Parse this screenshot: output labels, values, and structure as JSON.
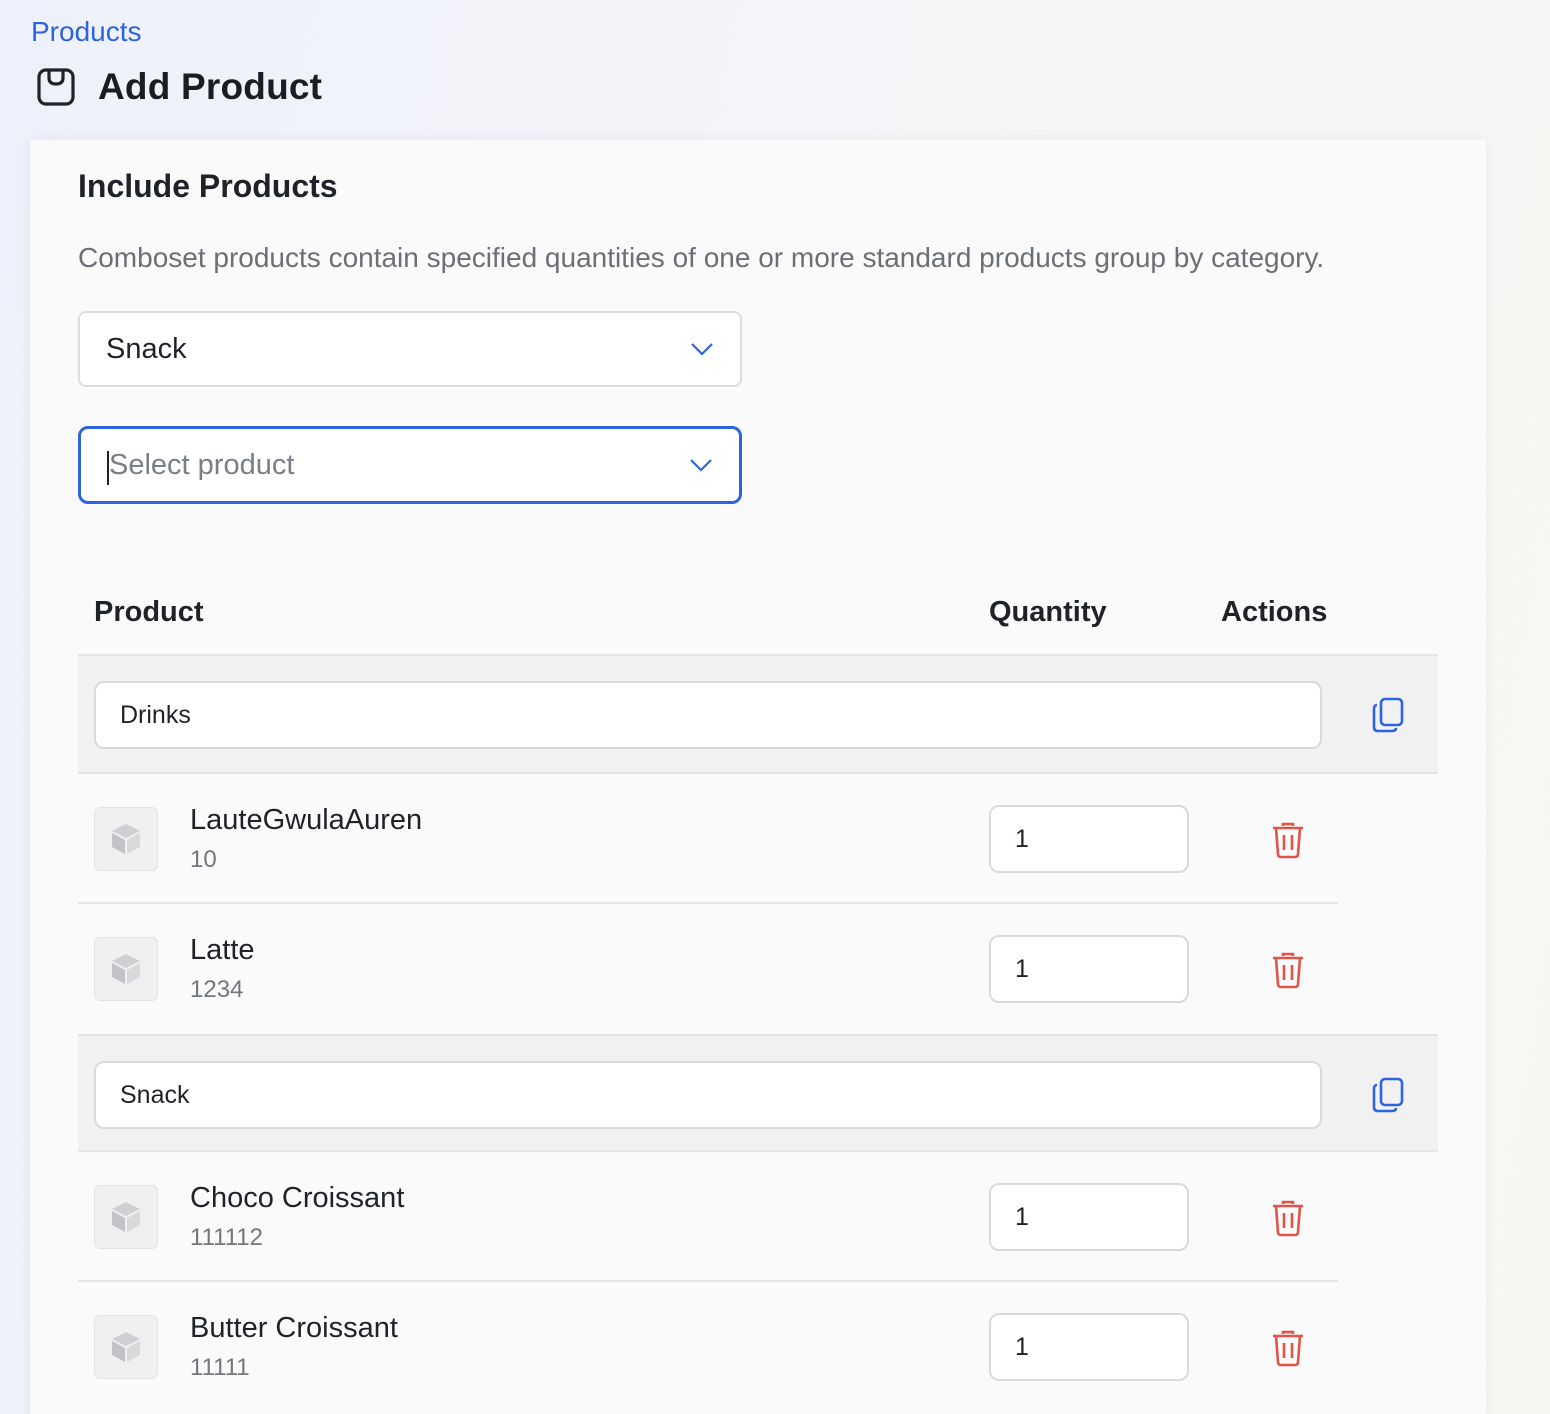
{
  "breadcrumb": {
    "label": "Products"
  },
  "header": {
    "title": "Add Product",
    "icon": "bag-icon"
  },
  "section": {
    "title": "Include Products",
    "description": "Comboset products contain specified quantities of one or more standard products group by category."
  },
  "category_select": {
    "value": "Snack"
  },
  "product_select": {
    "placeholder": "Select product"
  },
  "table": {
    "columns": {
      "product": "Product",
      "quantity": "Quantity",
      "actions": "Actions"
    },
    "groups": [
      {
        "name": "Drinks",
        "items": [
          {
            "name": "LauteGwulaAuren",
            "code": "10",
            "quantity": "1"
          },
          {
            "name": "Latte",
            "code": "1234",
            "quantity": "1"
          }
        ]
      },
      {
        "name": "Snack",
        "items": [
          {
            "name": "Choco Croissant",
            "code": "111112",
            "quantity": "1"
          },
          {
            "name": "Butter Croissant",
            "code": "11111",
            "quantity": "1"
          }
        ]
      }
    ]
  },
  "colors": {
    "accent": "#2f63e0",
    "danger": "#e0554a",
    "text": "#1f2329",
    "muted": "#6b6f76"
  }
}
